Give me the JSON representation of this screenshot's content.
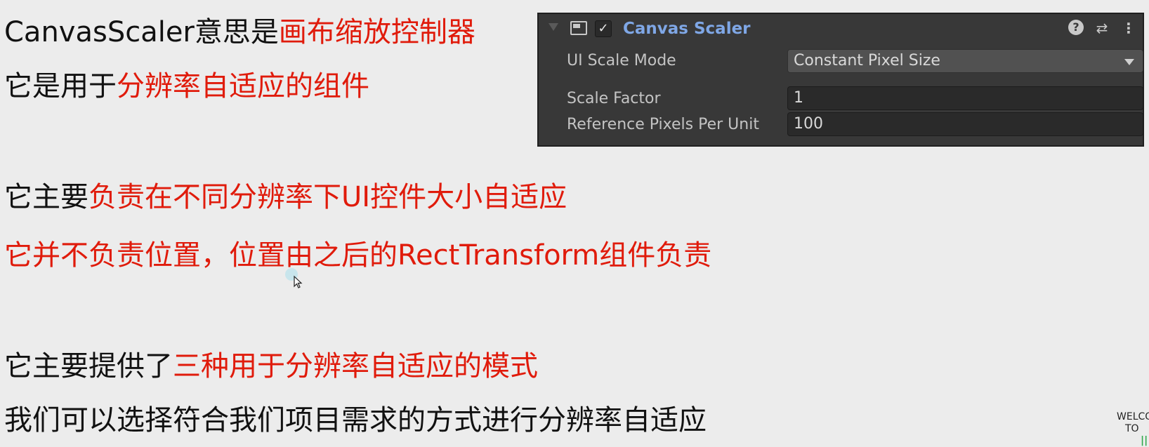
{
  "lines": [
    {
      "segments": [
        {
          "text": "CanvasScaler意思是",
          "color": "black"
        },
        {
          "text": "画布缩放控制器",
          "color": "red"
        }
      ]
    },
    {
      "segments": [
        {
          "text": "它是用于",
          "color": "black"
        },
        {
          "text": "分辨率自适应的组件",
          "color": "red"
        }
      ]
    },
    {
      "segments": [
        {
          "text": "它主要",
          "color": "black"
        },
        {
          "text": "负责在不同分辨率下UI控件大小自适应",
          "color": "red"
        }
      ]
    },
    {
      "segments": [
        {
          "text": "它并不负责位置，位置由之后的RectTransform组件负责",
          "color": "red"
        }
      ]
    },
    {
      "segments": [
        {
          "text": "它主要提供了",
          "color": "black"
        },
        {
          "text": "三种用于分辨率自适应的模式",
          "color": "red"
        }
      ]
    },
    {
      "segments": [
        {
          "text": "我们可以选择符合我们项目需求的方式进行分辨率自适应",
          "color": "black"
        }
      ]
    }
  ],
  "colors": {
    "red": "#e01b0b",
    "black": "#111111",
    "background": "#ececec",
    "panel_bg": "#383838",
    "title_blue": "#7fa7e6"
  },
  "inspector": {
    "title": "Canvas Scaler",
    "enabled_check": "✓",
    "help_icon": "?",
    "preset_icon": "⇄",
    "menu_icon": "⋮",
    "fields": [
      {
        "label": "UI Scale Mode",
        "value": "Constant Pixel Size",
        "kind": "dropdown"
      },
      {
        "label": "Scale Factor",
        "value": "1",
        "kind": "text"
      },
      {
        "label": "Reference Pixels Per Unit",
        "value": "100",
        "kind": "text"
      }
    ]
  },
  "corner": {
    "line1": "WELCO",
    "line2": "TO",
    "line3": "||"
  }
}
